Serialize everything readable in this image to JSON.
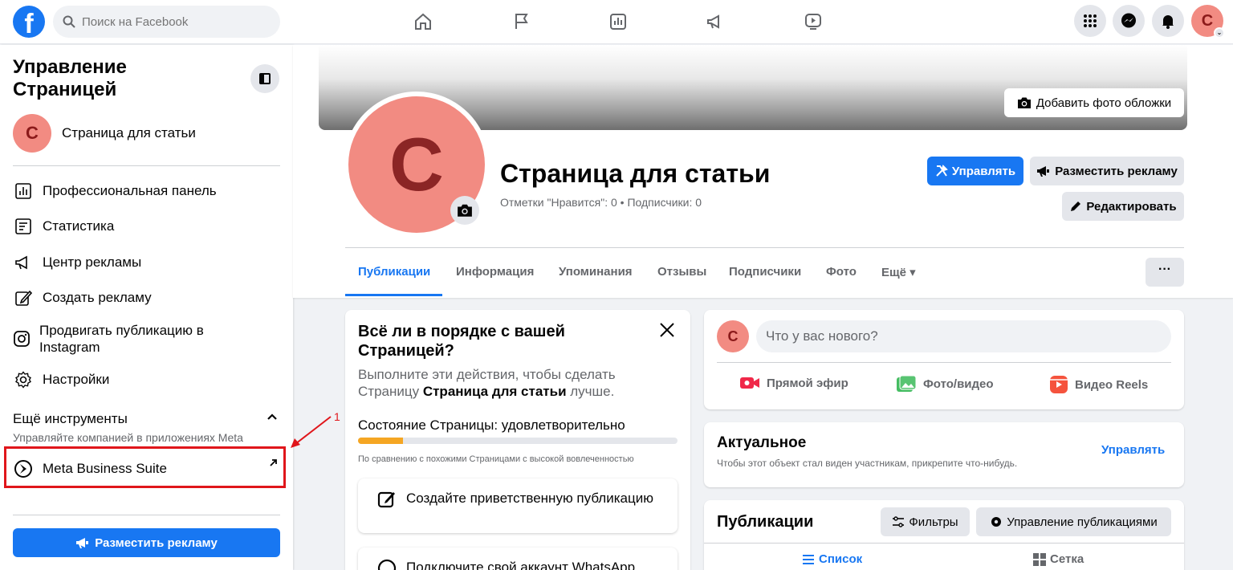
{
  "topbar": {
    "logo": "f",
    "search_placeholder": "Поиск на Facebook",
    "nav_icons": [
      "home-icon",
      "flag-icon",
      "insights-icon",
      "megaphone-icon",
      "video-icon"
    ],
    "right_icons": [
      "menu-grid-icon",
      "messenger-icon",
      "bell-icon"
    ],
    "avatar_letter": "C",
    "avatar_badge": "⌄"
  },
  "sidebar": {
    "title": "Управление Страницей",
    "page_letter": "C",
    "page_name": "Страница для статьи",
    "items": [
      {
        "label": "Профессиональная панель",
        "icon": "dashboard-icon"
      },
      {
        "label": "Статистика",
        "icon": "statistics-icon"
      },
      {
        "label": "Центр рекламы",
        "icon": "megaphone-icon"
      },
      {
        "label": "Создать рекламу",
        "icon": "pencil-icon"
      },
      {
        "label": "Продвигать публикацию в Instagram",
        "icon": "instagram-icon"
      },
      {
        "label": "Настройки",
        "icon": "gear-icon"
      }
    ],
    "more_tools_title": "Ещё инструменты",
    "more_tools_sub": "Управляйте компанией в приложениях Meta",
    "meta_business": "Meta Business Suite",
    "cta": "Разместить рекламу"
  },
  "annotation": {
    "number": "1",
    "color": "#e0161b"
  },
  "header": {
    "add_cover": "Добавить фото обложки",
    "avatar_letter": "C",
    "page_name": "Страница для статьи",
    "stats": "Отметки \"Нравится\": 0 • Подписчики: 0",
    "manage_btn": "Управлять",
    "advertise_btn": "Разместить рекламу",
    "edit_btn": "Редактировать",
    "tabs": [
      "Публикации",
      "Информация",
      "Упоминания",
      "Отзывы",
      "Подписчики",
      "Фото",
      "Ещё ▾"
    ],
    "more_btn": "···"
  },
  "health_card": {
    "title": "Всё ли в порядке с вашей Страницей?",
    "desc_prefix": "Выполните эти действия, чтобы сделать Страницу ",
    "desc_bold": "Страница для статьи",
    "desc_suffix": " лучше.",
    "state": "Состояние Страницы: удовлетворительно",
    "progress_fraction": 0.14,
    "note": "По сравнению с похожими Страницами с высокой вовлеченностью",
    "actions": [
      "Создайте приветственную публикацию",
      "Подключите свой аккаунт WhatsApp"
    ]
  },
  "composer": {
    "avatar_letter": "C",
    "placeholder": "Что у вас нового?",
    "actions": [
      "Прямой эфир",
      "Фото/видео",
      "Видео Reels"
    ]
  },
  "featured": {
    "title": "Актуальное",
    "subtitle": "Чтобы этот объект стал виден участникам, прикрепите что-нибудь.",
    "manage": "Управлять"
  },
  "posts": {
    "title": "Публикации",
    "filters": "Фильтры",
    "manage_posts": "Управление публикациями",
    "view_list": "Список",
    "view_grid": "Сетка"
  },
  "colors": {
    "brand": "#1877f2",
    "avatar": "#f28b82",
    "annotation": "#e0161b",
    "progress": "#f5a623"
  }
}
